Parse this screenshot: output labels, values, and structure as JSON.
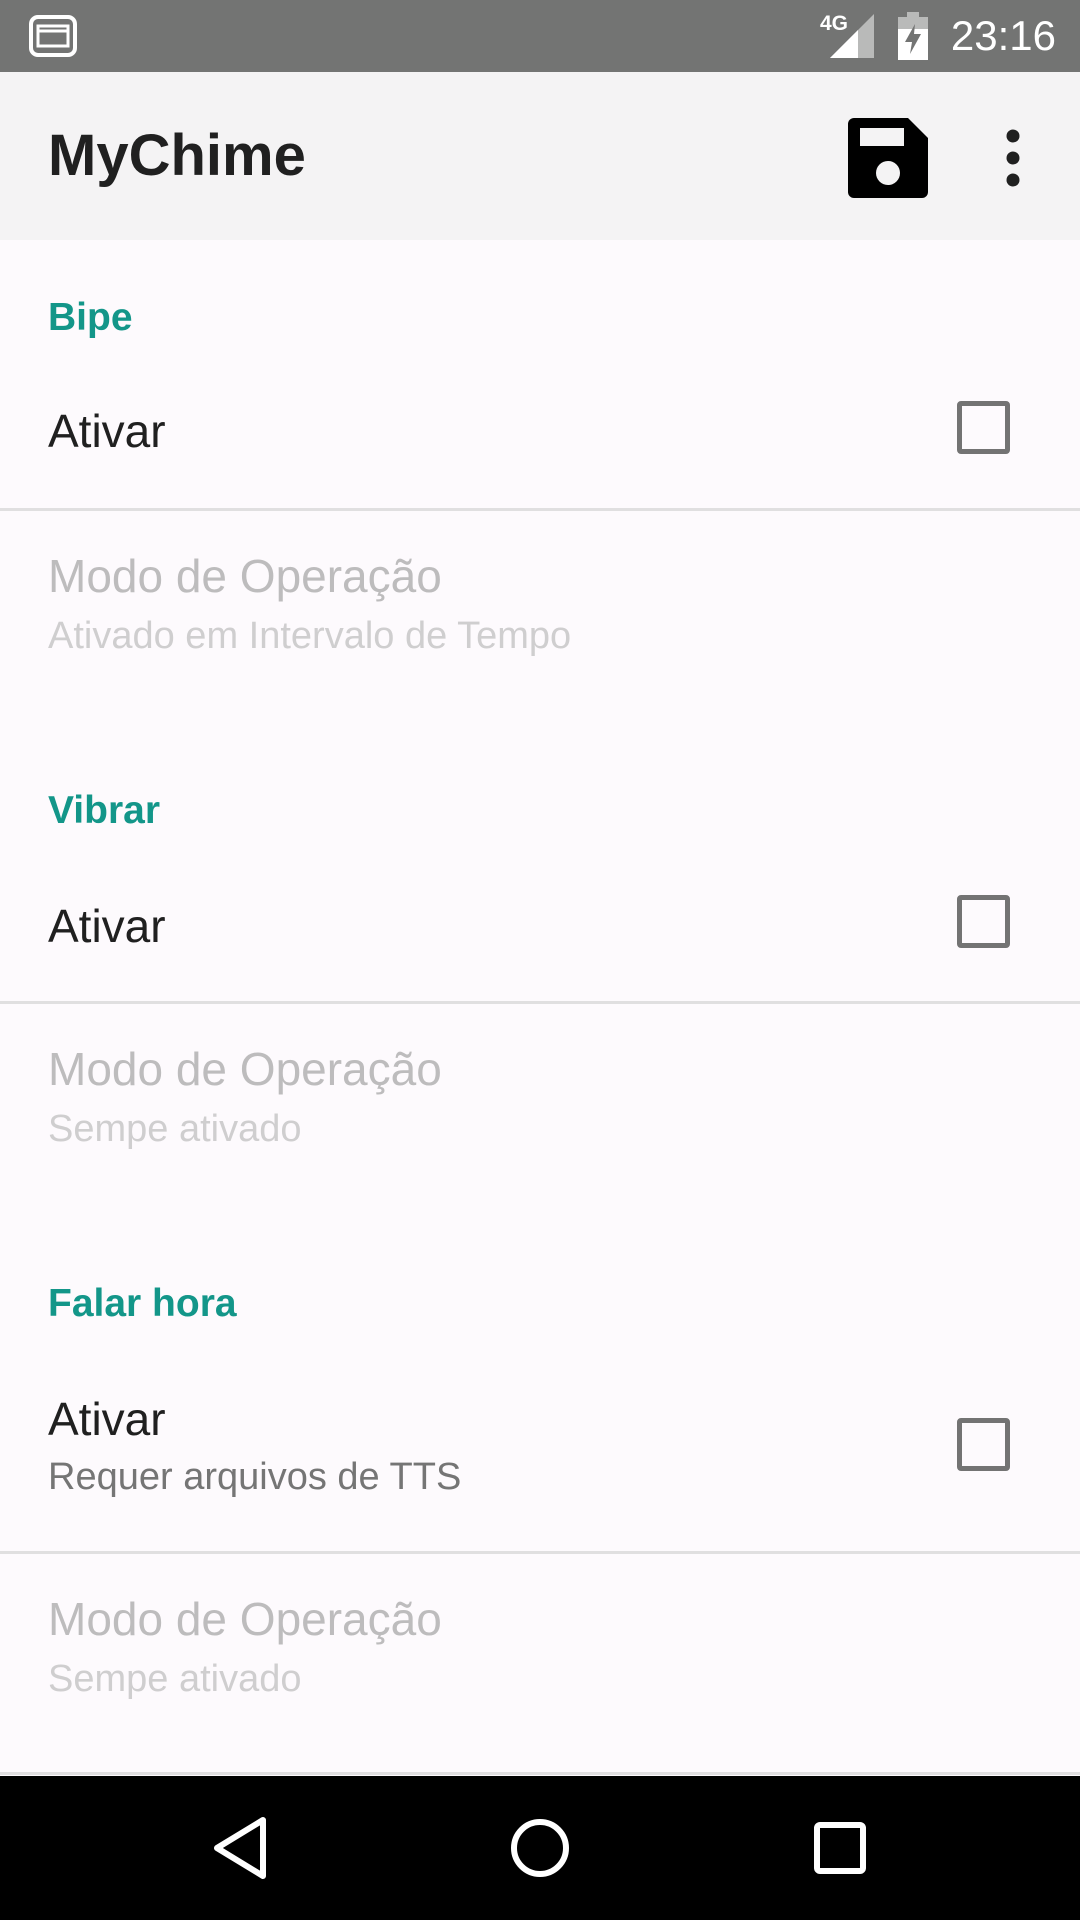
{
  "status_bar": {
    "network_label": "4G",
    "clock": "23:16",
    "icons": [
      "app-notification-icon",
      "signal-icon",
      "battery-charging-icon"
    ]
  },
  "app_bar": {
    "title": "MyChime",
    "actions": [
      "save-icon",
      "more-vert-icon"
    ]
  },
  "sections": [
    {
      "header": "Bipe",
      "enable": {
        "title": "Ativar",
        "summary": "",
        "checked": false
      },
      "mode": {
        "title": "Modo de Operação",
        "summary": "Ativado em Intervalo de Tempo",
        "enabled": false
      }
    },
    {
      "header": "Vibrar",
      "enable": {
        "title": "Ativar",
        "summary": "",
        "checked": false
      },
      "mode": {
        "title": "Modo de Operação",
        "summary": "Sempe ativado",
        "enabled": false
      }
    },
    {
      "header": "Falar hora",
      "enable": {
        "title": "Ativar",
        "summary": "Requer arquivos de TTS",
        "checked": false
      },
      "mode": {
        "title": "Modo de Operação",
        "summary": "Sempe ativado",
        "enabled": false
      }
    }
  ],
  "nav_bar": {
    "buttons": [
      "back-icon",
      "home-icon",
      "recents-icon"
    ]
  },
  "colors": {
    "accent": "#139689",
    "status_bar": "#737473",
    "app_bar": "#f4f3f4",
    "background": "#fdfafd"
  }
}
